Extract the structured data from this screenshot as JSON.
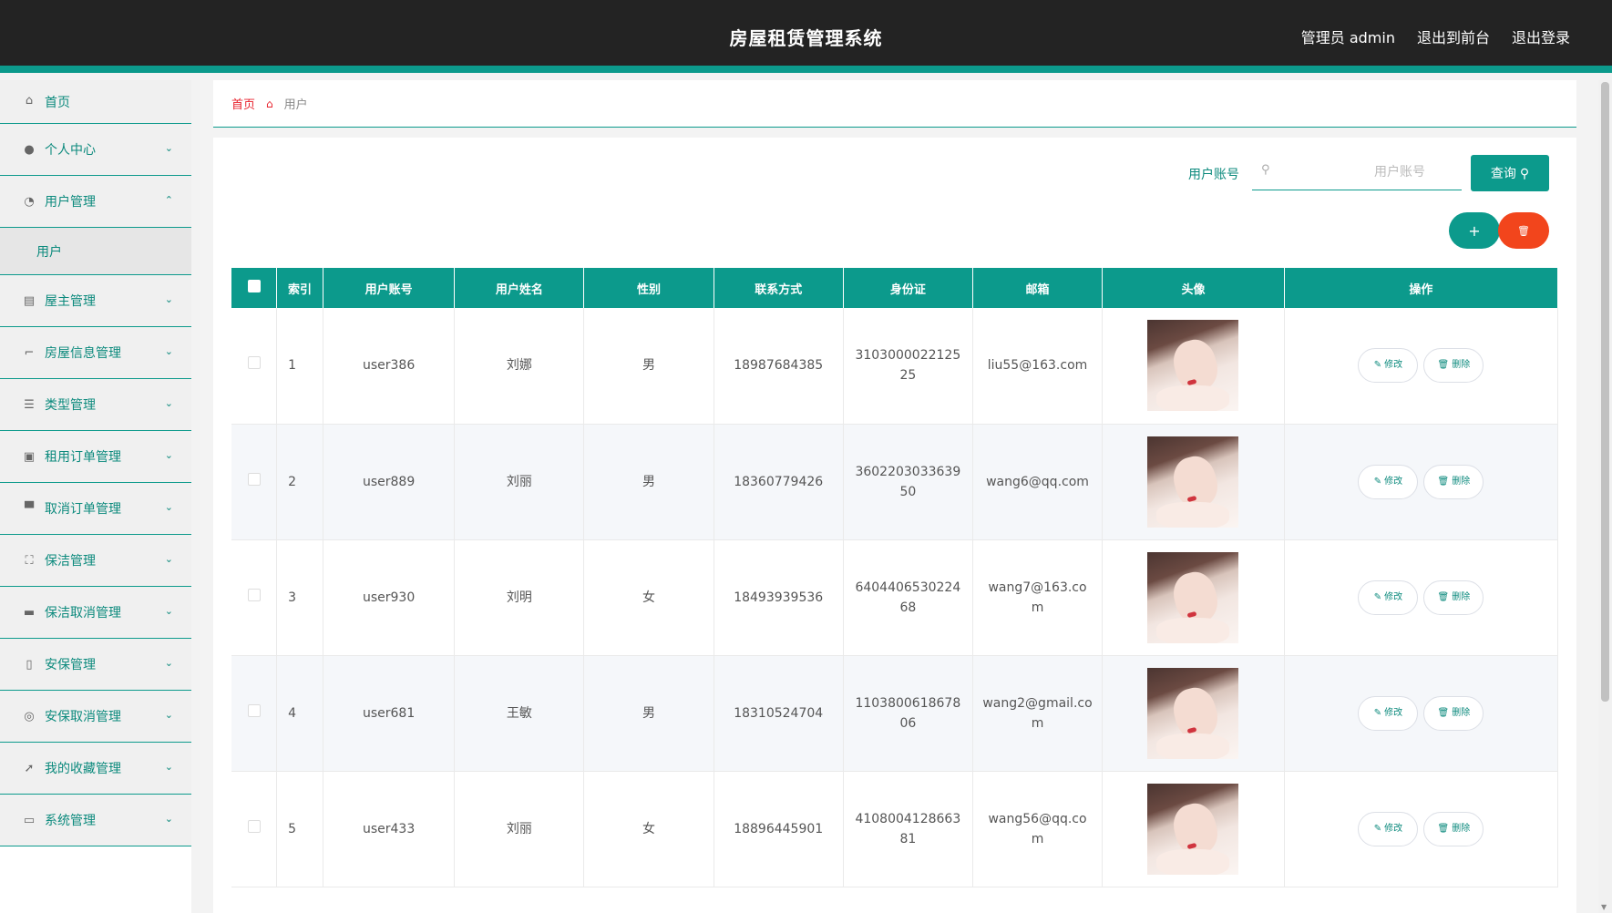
{
  "header": {
    "title": "房屋租赁管理系统",
    "admin": "管理员 admin",
    "to_front": "退出到前台",
    "logout": "退出登录"
  },
  "sidebar": {
    "items": [
      {
        "label": "首页",
        "icon": "home-icon"
      },
      {
        "label": "个人中心",
        "icon": "user-icon"
      },
      {
        "label": "用户管理",
        "icon": "gauge-icon",
        "expanded": true
      },
      {
        "label": "屋主管理",
        "icon": "clipboard-icon"
      },
      {
        "label": "房屋信息管理",
        "icon": "crop-icon"
      },
      {
        "label": "类型管理",
        "icon": "list-icon"
      },
      {
        "label": "租用订单管理",
        "icon": "checklist-icon"
      },
      {
        "label": "取消订单管理",
        "icon": "stand-icon"
      },
      {
        "label": "保洁管理",
        "icon": "frame-icon"
      },
      {
        "label": "保洁取消管理",
        "icon": "briefcase-icon"
      },
      {
        "label": "安保管理",
        "icon": "phone-icon"
      },
      {
        "label": "安保取消管理",
        "icon": "circle-icon"
      },
      {
        "label": "我的收藏管理",
        "icon": "send-icon"
      },
      {
        "label": "系统管理",
        "icon": "monitor-icon"
      }
    ],
    "sub_item": "用户"
  },
  "breadcrumb": {
    "home": "首页",
    "current": "用户"
  },
  "search": {
    "label": "用户账号",
    "placeholder": "用户账号",
    "button": "查询"
  },
  "actions": {
    "add": "+",
    "delete": "🗑"
  },
  "table": {
    "headers": [
      "索引",
      "用户账号",
      "用户姓名",
      "性别",
      "联系方式",
      "身份证",
      "邮箱",
      "头像",
      "操作"
    ],
    "edit_label": "修改",
    "delete_label": "删除",
    "rows": [
      {
        "index": "1",
        "account": "user386",
        "name": "刘娜",
        "gender": "男",
        "phone": "18987684385",
        "id_card": "310300002212525",
        "email": "liu55@163.com"
      },
      {
        "index": "2",
        "account": "user889",
        "name": "刘丽",
        "gender": "男",
        "phone": "18360779426",
        "id_card": "360220303363950",
        "email": "wang6@qq.com"
      },
      {
        "index": "3",
        "account": "user930",
        "name": "刘明",
        "gender": "女",
        "phone": "18493939536",
        "id_card": "640440653022468",
        "email": "wang7@163.com"
      },
      {
        "index": "4",
        "account": "user681",
        "name": "王敏",
        "gender": "男",
        "phone": "18310524704",
        "id_card": "110380061867806",
        "email": "wang2@gmail.com"
      },
      {
        "index": "5",
        "account": "user433",
        "name": "刘丽",
        "gender": "女",
        "phone": "18896445901",
        "id_card": "410800412866381",
        "email": "wang56@qq.com"
      }
    ]
  },
  "colors": {
    "accent": "#0c9a8c",
    "danger": "#f2451c",
    "header_bg": "#232323",
    "breadcrumb_home": "#e8222d"
  }
}
